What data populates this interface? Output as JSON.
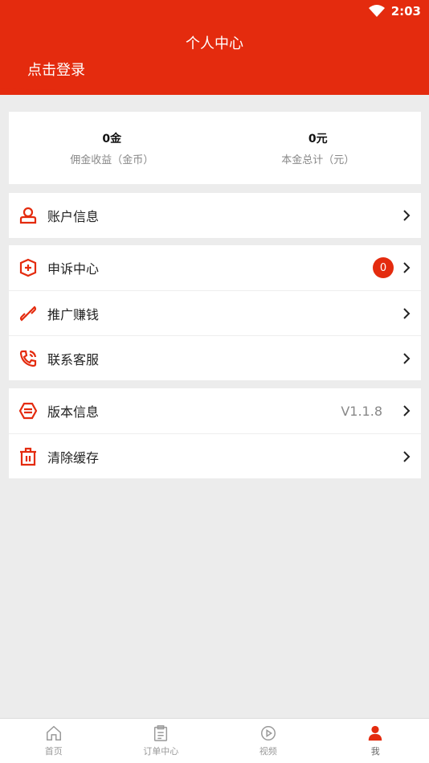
{
  "status": {
    "time": "2:03"
  },
  "header": {
    "title": "个人中心",
    "login": "点击登录"
  },
  "stats": [
    {
      "value": "0金",
      "label": "佣金收益（金币）"
    },
    {
      "value": "0元",
      "label": "本金总计（元）"
    }
  ],
  "menu": {
    "account": "账户信息",
    "appeal": "申诉中心",
    "appeal_badge": "0",
    "promote": "推广赚钱",
    "service": "联系客服",
    "version": "版本信息",
    "version_value": "V1.1.8",
    "clear": "清除缓存"
  },
  "tabs": [
    {
      "label": "首页",
      "icon": "home-icon"
    },
    {
      "label": "订单中心",
      "icon": "clipboard-icon"
    },
    {
      "label": "视频",
      "icon": "play-icon"
    },
    {
      "label": "我",
      "icon": "user-icon"
    }
  ],
  "colors": {
    "accent": "#e42b0e",
    "background": "#ececec"
  }
}
